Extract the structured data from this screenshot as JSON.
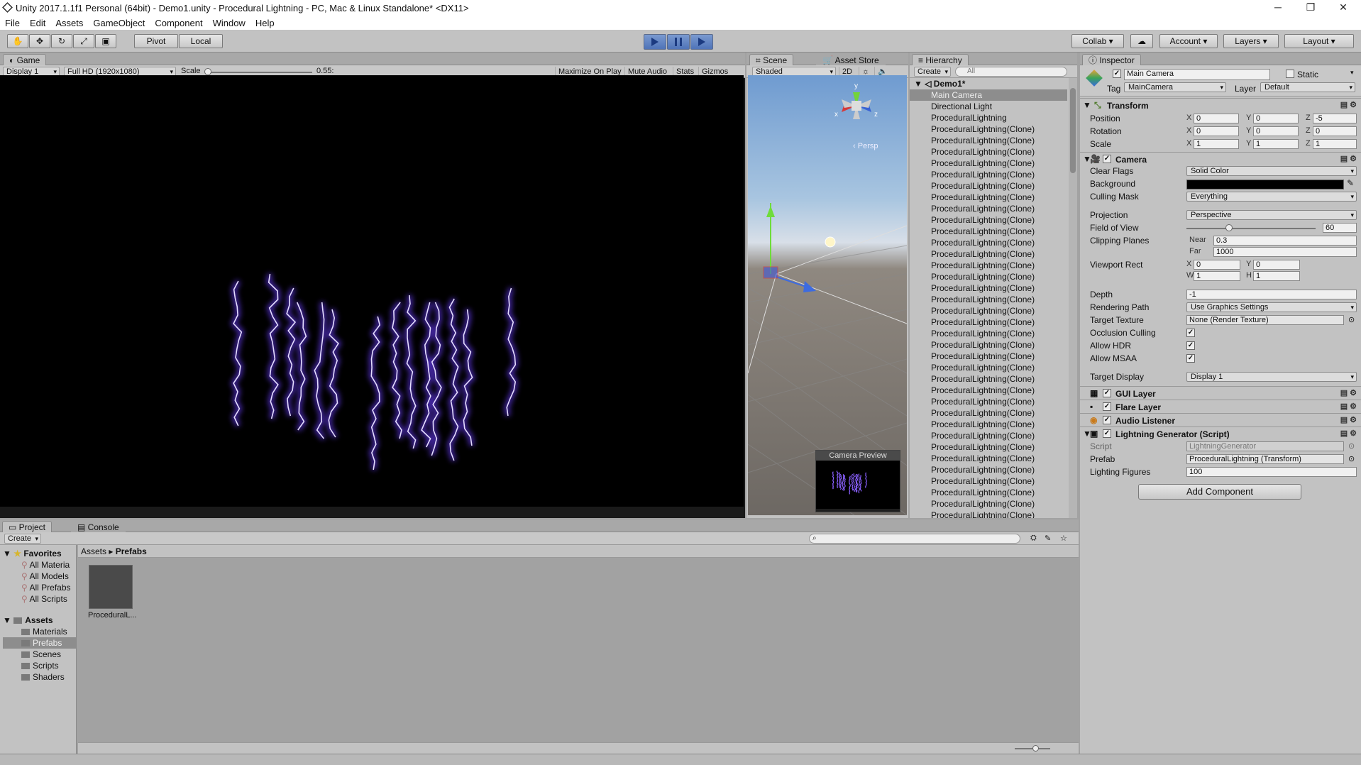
{
  "window": {
    "title": "Unity 2017.1.1f1 Personal (64bit) - Demo1.unity - Procedural Lightning - PC, Mac & Linux Standalone* <DX11>",
    "controls": [
      "─",
      "❐",
      "✕"
    ]
  },
  "menu": [
    "File",
    "Edit",
    "Assets",
    "GameObject",
    "Component",
    "Window",
    "Help"
  ],
  "toolbar": {
    "pivot": "Pivot",
    "local": "Local",
    "collab": "Collab",
    "account": "Account",
    "layers": "Layers",
    "layout": "Layout"
  },
  "game": {
    "tab": "Game",
    "display": "Display 1",
    "resolution": "Full HD (1920x1080)",
    "scale_label": "Scale",
    "scale_value": "0.55:",
    "maximize": "Maximize On Play",
    "mute": "Mute Audio",
    "stats": "Stats",
    "gizmos": "Gizmos"
  },
  "scene": {
    "tab": "Scene",
    "asset_store": "Asset Store",
    "shading": "Shaded",
    "mode2d": "2D",
    "persp": "Persp",
    "camera_preview": "Camera Preview",
    "axis_y": "y",
    "axis_x": "x",
    "axis_z": "z"
  },
  "hierarchy": {
    "tab": "Hierarchy",
    "create": "Create",
    "search": "All",
    "scene_name": "Demo1*",
    "items": [
      {
        "name": "Main Camera",
        "selected": true
      },
      {
        "name": "Directional Light"
      },
      {
        "name": "ProceduralLightning"
      },
      {
        "name": "ProceduralLightning(Clone)"
      },
      {
        "name": "ProceduralLightning(Clone)"
      },
      {
        "name": "ProceduralLightning(Clone)"
      },
      {
        "name": "ProceduralLightning(Clone)"
      },
      {
        "name": "ProceduralLightning(Clone)"
      },
      {
        "name": "ProceduralLightning(Clone)"
      },
      {
        "name": "ProceduralLightning(Clone)"
      },
      {
        "name": "ProceduralLightning(Clone)"
      },
      {
        "name": "ProceduralLightning(Clone)"
      },
      {
        "name": "ProceduralLightning(Clone)"
      },
      {
        "name": "ProceduralLightning(Clone)"
      },
      {
        "name": "ProceduralLightning(Clone)"
      },
      {
        "name": "ProceduralLightning(Clone)"
      },
      {
        "name": "ProceduralLightning(Clone)"
      },
      {
        "name": "ProceduralLightning(Clone)"
      },
      {
        "name": "ProceduralLightning(Clone)"
      },
      {
        "name": "ProceduralLightning(Clone)"
      },
      {
        "name": "ProceduralLightning(Clone)"
      },
      {
        "name": "ProceduralLightning(Clone)"
      },
      {
        "name": "ProceduralLightning(Clone)"
      },
      {
        "name": "ProceduralLightning(Clone)"
      },
      {
        "name": "ProceduralLightning(Clone)"
      },
      {
        "name": "ProceduralLightning(Clone)"
      },
      {
        "name": "ProceduralLightning(Clone)"
      },
      {
        "name": "ProceduralLightning(Clone)"
      },
      {
        "name": "ProceduralLightning(Clone)"
      },
      {
        "name": "ProceduralLightning(Clone)"
      },
      {
        "name": "ProceduralLightning(Clone)"
      },
      {
        "name": "ProceduralLightning(Clone)"
      },
      {
        "name": "ProceduralLightning(Clone)"
      },
      {
        "name": "ProceduralLightning(Clone)"
      },
      {
        "name": "ProceduralLightning(Clone)"
      },
      {
        "name": "ProceduralLightning(Clone)"
      },
      {
        "name": "ProceduralLightning(Clone)"
      },
      {
        "name": "ProceduralLightning(Clone)"
      },
      {
        "name": "ProceduralLightning(Clone)"
      },
      {
        "name": "ProceduralLightning(Clone)"
      }
    ]
  },
  "inspector": {
    "tab": "Inspector",
    "object_name": "Main Camera",
    "static": "Static",
    "tag_label": "Tag",
    "tag": "MainCamera",
    "layer_label": "Layer",
    "layer": "Default",
    "transform": {
      "title": "Transform",
      "position_label": "Position",
      "rotation_label": "Rotation",
      "scale_label": "Scale",
      "position": [
        "0",
        "0",
        "-5"
      ],
      "rotation": [
        "0",
        "0",
        "0"
      ],
      "scale": [
        "1",
        "1",
        "1"
      ]
    },
    "camera": {
      "title": "Camera",
      "clear_flags_label": "Clear Flags",
      "clear_flags": "Solid Color",
      "background_label": "Background",
      "background_color": "#000000",
      "culling_mask_label": "Culling Mask",
      "culling_mask": "Everything",
      "projection_label": "Projection",
      "projection": "Perspective",
      "fov_label": "Field of View",
      "fov": "60",
      "fov_slider_fraction": 0.33,
      "clipping_label": "Clipping Planes",
      "near_label": "Near",
      "near": "0.3",
      "far_label": "Far",
      "far": "1000",
      "viewport_label": "Viewport Rect",
      "viewport": {
        "x": "0",
        "y": "0",
        "w": "1",
        "h": "1"
      },
      "depth_label": "Depth",
      "depth": "-1",
      "rendering_path_label": "Rendering Path",
      "rendering_path": "Use Graphics Settings",
      "target_texture_label": "Target Texture",
      "target_texture": "None (Render Texture)",
      "occlusion_label": "Occlusion Culling",
      "hdr_label": "Allow HDR",
      "msaa_label": "Allow MSAA",
      "target_display_label": "Target Display",
      "target_display": "Display 1"
    },
    "components": [
      "GUI Layer",
      "Flare Layer",
      "Audio Listener"
    ],
    "script_component": {
      "title": "Lightning Generator (Script)",
      "script_label": "Script",
      "script": "LightningGenerator",
      "prefab_label": "Prefab",
      "prefab": "ProceduralLightning (Transform)",
      "figures_label": "Lighting Figures",
      "figures": "100"
    },
    "add_component": "Add Component"
  },
  "project": {
    "tab": "Project",
    "console_tab": "Console",
    "create": "Create",
    "favorites_label": "Favorites",
    "favorites": [
      "All Materia",
      "All Models",
      "All Prefabs",
      "All Scripts"
    ],
    "assets_label": "Assets",
    "folders": [
      "Materials",
      "Prefabs",
      "Scenes",
      "Scripts",
      "Shaders"
    ],
    "breadcrumb": [
      "Assets",
      "Prefabs"
    ],
    "asset_item": "ProceduralL..."
  }
}
